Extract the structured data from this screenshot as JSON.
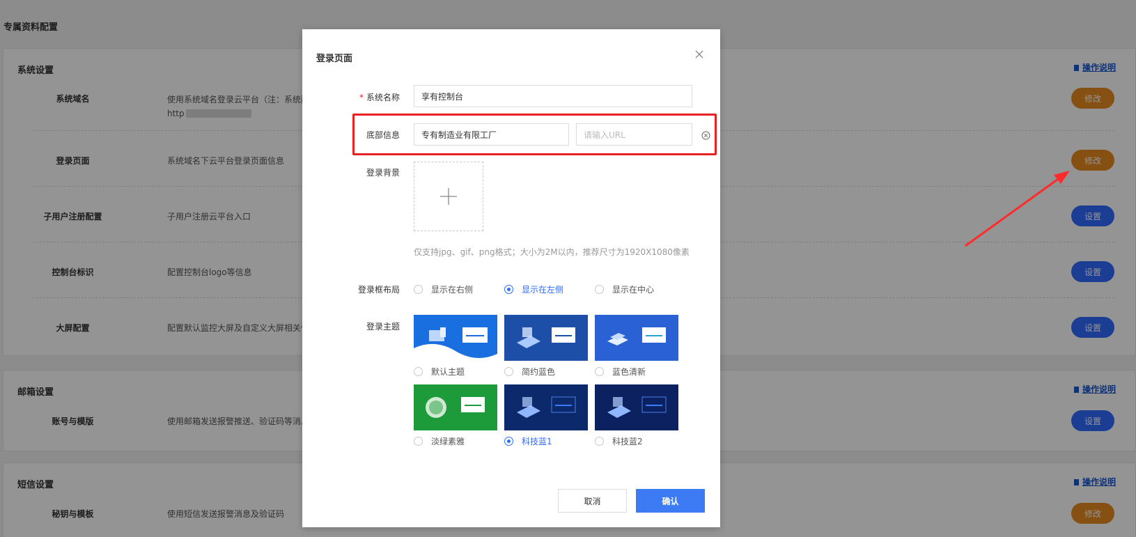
{
  "page": {
    "title": "专属资料配置",
    "help_label": "操作说明",
    "sections": [
      {
        "title": "系统设置",
        "rows": [
          {
            "label": "系统域名",
            "desc": "使用系统域名登录云平台（注：系统配",
            "desc2": "http",
            "action": "修改"
          },
          {
            "label": "登录页面",
            "desc": "系统域名下云平台登录页面信息",
            "action": "修改"
          },
          {
            "label": "子用户注册配置",
            "desc": "子用户注册云平台入口",
            "action": "设置"
          },
          {
            "label": "控制台标识",
            "desc": "配置控制台logo等信息",
            "action": "设置"
          },
          {
            "label": "大屏配置",
            "desc": "配置默认监控大屏及自定义大屏相关信",
            "action": "设置"
          }
        ]
      },
      {
        "title": "邮箱设置",
        "rows": [
          {
            "label": "账号与模版",
            "desc": "使用邮箱发送报警推送、验证码等消息",
            "action": "设置"
          }
        ]
      },
      {
        "title": "短信设置",
        "rows": [
          {
            "label": "秘钥与模板",
            "desc": "使用短信发送报警消息及验证码",
            "action": "修改"
          }
        ]
      }
    ]
  },
  "modal": {
    "title": "登录页面",
    "system_name": {
      "label": "系统名称",
      "required_mark": "*",
      "value": "享有控制台"
    },
    "footer_info": {
      "label": "底部信息",
      "value": "专有制造业有限工厂",
      "url_placeholder": "请输入URL"
    },
    "background": {
      "label": "登录背景",
      "hint": "仅支持jpg、gif、png格式；大小为2M以内，推荐尺寸为1920X1080像素"
    },
    "layout": {
      "label": "登录框布局",
      "options": [
        "显示在右侧",
        "显示在左侧",
        "显示在中心"
      ],
      "selected": 1
    },
    "theme": {
      "label": "登录主题",
      "options": [
        {
          "name": "默认主题",
          "color": "#1a6fe0"
        },
        {
          "name": "简约蓝色",
          "color": "#1e4fa8"
        },
        {
          "name": "蓝色清新",
          "color": "#2a62d6"
        },
        {
          "name": "淡绿素雅",
          "color": "#1d9a3a"
        },
        {
          "name": "科技蓝1",
          "color": "#0c2a6b"
        },
        {
          "name": "科技蓝2",
          "color": "#0c2260"
        }
      ],
      "selected": 4
    },
    "cancel_label": "取消",
    "confirm_label": "确认"
  },
  "colors": {
    "orange_button": "#e58a1f",
    "blue_button": "#2f6bff",
    "highlight": "#e52323"
  }
}
